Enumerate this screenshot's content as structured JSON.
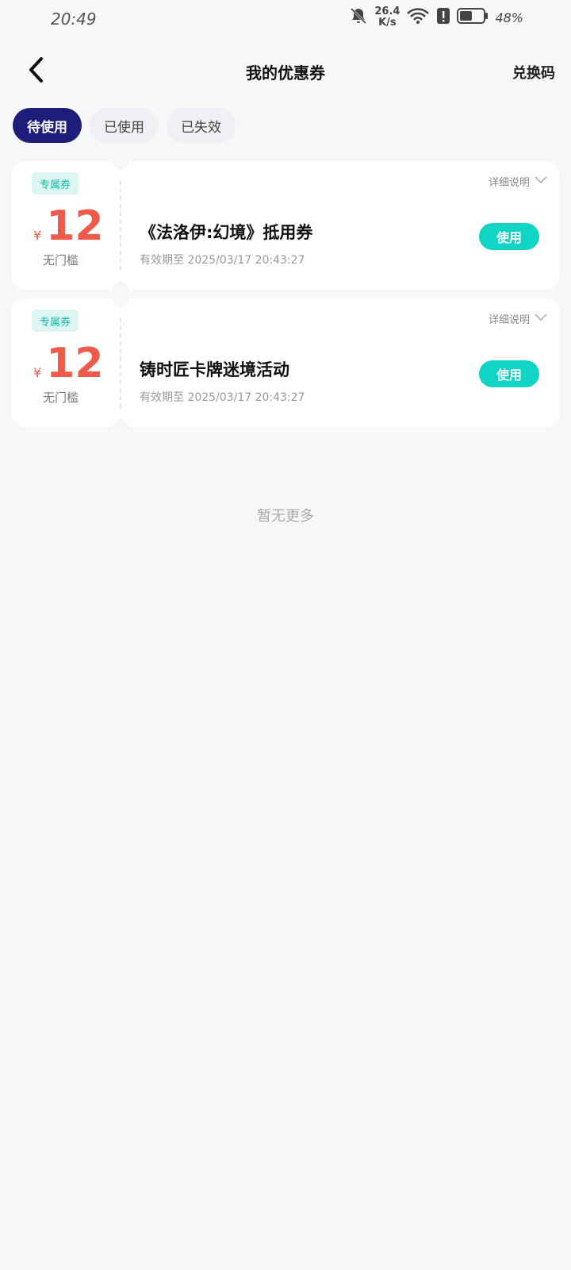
{
  "status": {
    "time": "20:49",
    "net_speed_value": "26.4",
    "net_speed_unit": "K/s",
    "battery": "48%"
  },
  "nav": {
    "title": "我的优惠券",
    "redeem": "兑换码"
  },
  "tabs": [
    {
      "label": "待使用",
      "active": true
    },
    {
      "label": "已使用",
      "active": false
    },
    {
      "label": "已失效",
      "active": false
    }
  ],
  "coupons": [
    {
      "tag": "专属券",
      "currency": "¥",
      "value": "12",
      "threshold": "无门槛",
      "detail": "详细说明",
      "name": "《法洛伊:幻境》抵用券",
      "expiry": "有效期至 2025/03/17 20:43:27",
      "action": "使用"
    },
    {
      "tag": "专属券",
      "currency": "¥",
      "value": "12",
      "threshold": "无门槛",
      "detail": "详细说明",
      "name": "铸时匠卡牌迷境活动",
      "expiry": "有效期至 2025/03/17 20:43:27",
      "action": "使用"
    }
  ],
  "footer": {
    "no_more": "暂无更多"
  },
  "colors": {
    "accent": "#1f1d7a",
    "price": "#ef5a4a",
    "use_button": "#10d4c4",
    "tag_bg": "#dcf7f3",
    "tag_text": "#14b8a6"
  }
}
